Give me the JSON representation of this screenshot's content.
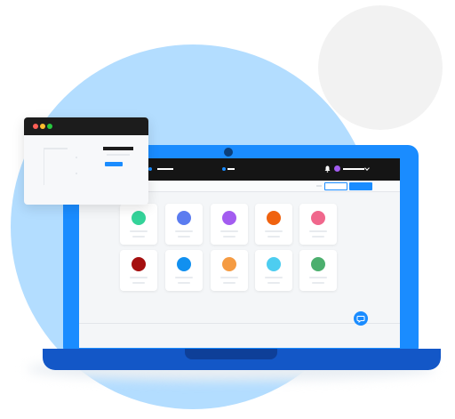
{
  "colors": {
    "accent": "#1a8cff",
    "laptop_base": "#1357c7",
    "topbar": "#151515",
    "bg_circle": "#b3ddff"
  },
  "apps": [
    {
      "color": "#34d399"
    },
    {
      "color": "#5b7cf0"
    },
    {
      "color": "#a35cf0"
    },
    {
      "color": "#f0620f"
    },
    {
      "color": "#f0678c"
    },
    {
      "color": "#a50f0f"
    },
    {
      "color": "#1190f0"
    },
    {
      "color": "#f59b42"
    },
    {
      "color": "#4dcdf0"
    },
    {
      "color": "#4caf6e"
    }
  ],
  "popup": {
    "traffic_lights": [
      "#ff5f56",
      "#ffbd2e",
      "#27c93f"
    ]
  },
  "icons": {
    "bell": "bell-icon",
    "avatar": "user-avatar",
    "chat": "chat-icon"
  }
}
